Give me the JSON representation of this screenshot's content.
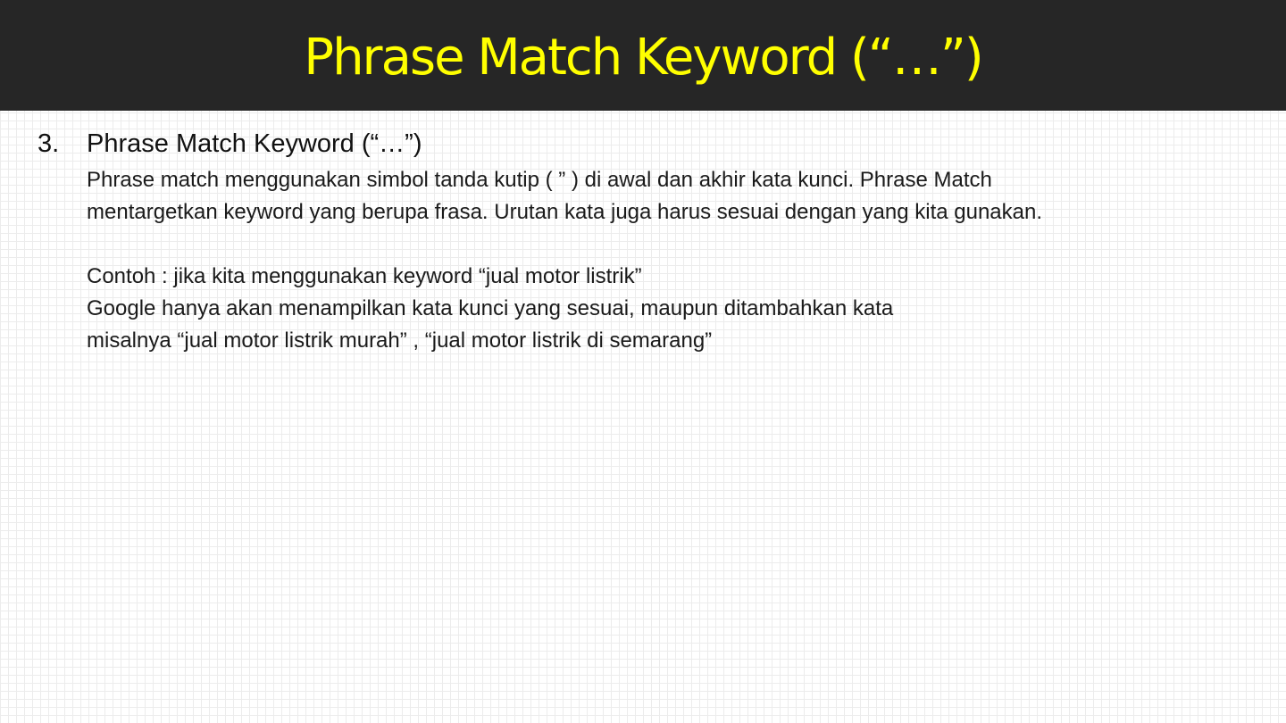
{
  "slide": {
    "title": "Phrase Match Keyword (“…”)",
    "item": {
      "number": "3.",
      "heading": "Phrase Match Keyword (“…”)",
      "body": [
        "Phrase match menggunakan simbol tanda kutip ( ” ) di awal dan akhir kata kunci. Phrase Match",
        "mentargetkan keyword yang berupa frasa. Urutan kata juga harus sesuai dengan yang kita gunakan.",
        "",
        "Contoh : jika kita menggunakan keyword “jual motor listrik”",
        "Google hanya akan menampilkan kata kunci yang sesuai, maupun ditambahkan kata",
        "misalnya “jual motor listrik murah” , “jual motor listrik di semarang”"
      ]
    }
  },
  "colors": {
    "title_bar": "#262626",
    "title_text": "#ffff00",
    "body_text": "#1a1a1a"
  }
}
